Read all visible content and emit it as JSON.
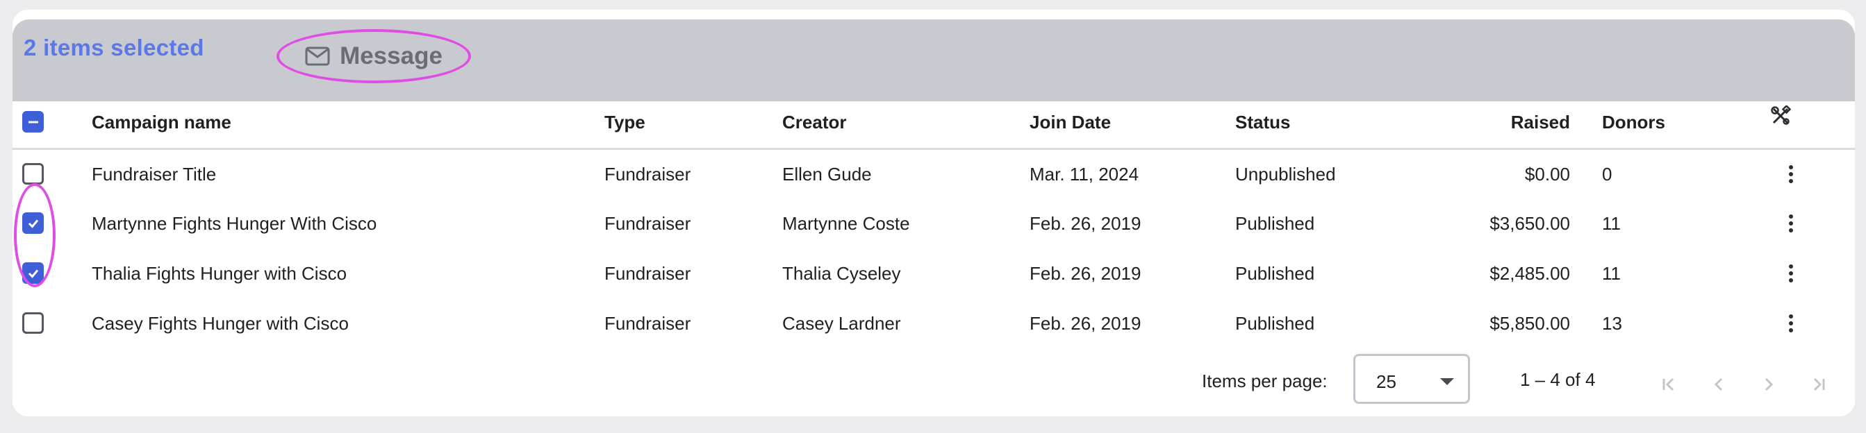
{
  "selection": {
    "count_text": "2 items selected",
    "message_label": "Message",
    "message_icon": "envelope-icon"
  },
  "table": {
    "columns": [
      {
        "key": "name",
        "label": "Campaign name"
      },
      {
        "key": "type",
        "label": "Type"
      },
      {
        "key": "creator",
        "label": "Creator"
      },
      {
        "key": "join_date",
        "label": "Join Date"
      },
      {
        "key": "status",
        "label": "Status"
      },
      {
        "key": "raised",
        "label": "Raised"
      },
      {
        "key": "donors",
        "label": "Donors"
      }
    ],
    "settings_icon": "tools-icon",
    "header_checkbox_state": "indeterminate",
    "rows": [
      {
        "checked": false,
        "name": "Fundraiser Title",
        "type": "Fundraiser",
        "creator": "Ellen Gude",
        "join_date": "Mar. 11, 2024",
        "status": "Unpublished",
        "raised": "$0.00",
        "donors": "0"
      },
      {
        "checked": true,
        "name": "Martynne Fights Hunger With Cisco",
        "type": "Fundraiser",
        "creator": "Martynne Coste",
        "join_date": "Feb. 26, 2019",
        "status": "Published",
        "raised": "$3,650.00",
        "donors": "11"
      },
      {
        "checked": true,
        "name": "Thalia Fights Hunger with Cisco",
        "type": "Fundraiser",
        "creator": "Thalia Cyseley",
        "join_date": "Feb. 26, 2019",
        "status": "Published",
        "raised": "$2,485.00",
        "donors": "11"
      },
      {
        "checked": false,
        "name": "Casey Fights Hunger with Cisco",
        "type": "Fundraiser",
        "creator": "Casey Lardner",
        "join_date": "Feb. 26, 2019",
        "status": "Published",
        "raised": "$5,850.00",
        "donors": "13"
      }
    ]
  },
  "pagination": {
    "items_per_page_label": "Items per page:",
    "items_per_page_value": "25",
    "range_text": "1 – 4 of 4"
  },
  "colors": {
    "accent": "#3f5fd8",
    "selection_bar": "#c9cad0",
    "highlight": "#e04ce6",
    "count_text": "#5b78e8"
  }
}
